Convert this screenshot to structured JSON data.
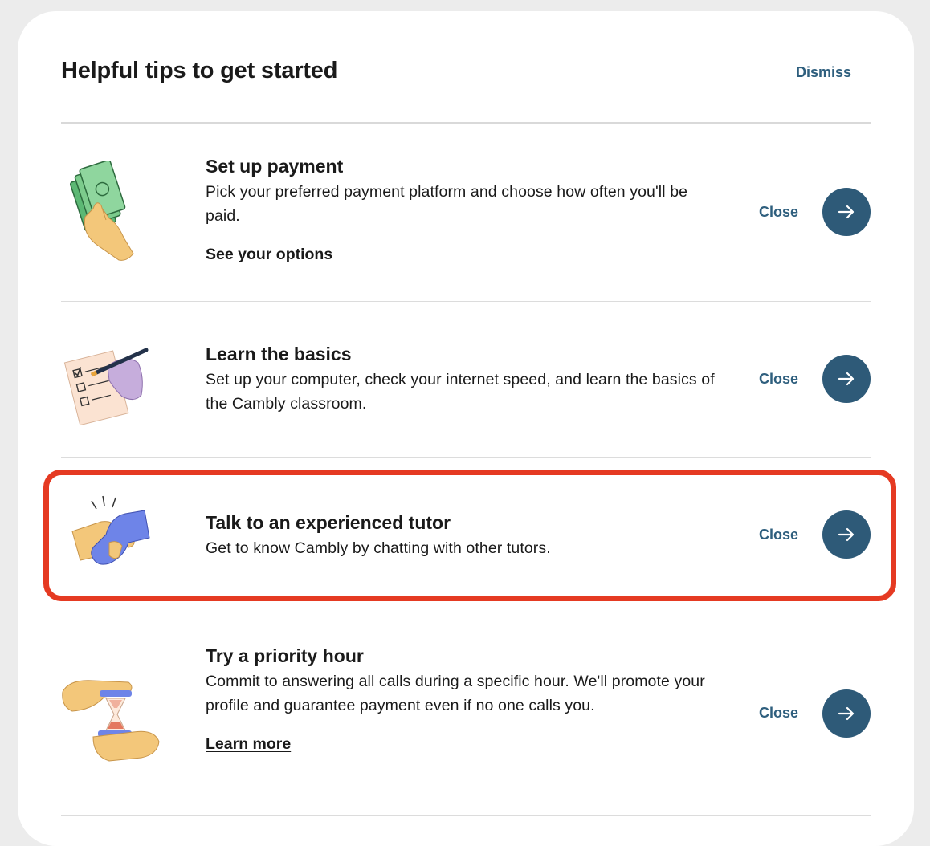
{
  "header": {
    "title": "Helpful tips to get started",
    "dismiss_label": "Dismiss"
  },
  "tips": [
    {
      "title": "Set up payment",
      "description": "Pick your preferred payment platform and choose how often you'll be paid.",
      "link": "See your options",
      "close_label": "Close",
      "illustration": "money-hand-icon"
    },
    {
      "title": "Learn the basics",
      "description": "Set up your computer, check your internet speed, and learn the basics of the Cambly classroom.",
      "close_label": "Close",
      "illustration": "checklist-pen-icon"
    },
    {
      "title": "Talk to an experienced tutor",
      "description": "Get to know Cambly by chatting with other tutors.",
      "close_label": "Close",
      "illustration": "handshake-icon",
      "highlighted": true
    },
    {
      "title": "Try a priority hour",
      "description": "Commit to answering all calls during a specific hour. We'll promote your profile and guarantee payment even if no one calls you.",
      "link": "Learn more",
      "close_label": "Close",
      "illustration": "hourglass-hands-icon"
    }
  ],
  "colors": {
    "accent": "#2e5a78",
    "link_text": "#2f5f7e",
    "highlight_border": "#e53a22",
    "background": "#ececec"
  }
}
